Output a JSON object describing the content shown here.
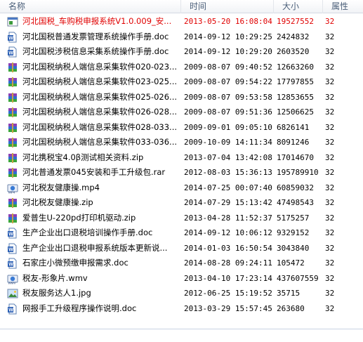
{
  "columns": {
    "name": "名称",
    "time": "时间",
    "size": "大小",
    "attr": "属性"
  },
  "rows": [
    {
      "name": "河北国税_车购税申报系统V1.0.009_安...",
      "time": "2013-05-20 16:08:04",
      "size": "19527552",
      "attr": "32",
      "icon": "installer-icon",
      "selected": true
    },
    {
      "name": "河北国税普通发票管理系统操作手册.doc",
      "time": "2014-09-12 10:29:25",
      "size": "2424832",
      "attr": "32",
      "icon": "word-doc-icon"
    },
    {
      "name": "河北国税涉税信息采集系统操作手册.doc",
      "time": "2014-09-12 10:29:20",
      "size": "2603520",
      "attr": "32",
      "icon": "word-doc-icon"
    },
    {
      "name": "河北国税纳税人端信息采集软件020-023...",
      "time": "2009-08-07 09:40:52",
      "size": "12663260",
      "attr": "32",
      "icon": "rar-archive-icon"
    },
    {
      "name": "河北国税纳税人端信息采集软件023-025...",
      "time": "2009-08-07 09:54:22",
      "size": "17797855",
      "attr": "32",
      "icon": "rar-archive-icon"
    },
    {
      "name": "河北国税纳税人端信息采集软件025-026...",
      "time": "2009-08-07 09:53:58",
      "size": "12853655",
      "attr": "32",
      "icon": "rar-archive-icon"
    },
    {
      "name": "河北国税纳税人端信息采集软件026-028...",
      "time": "2009-08-07 09:51:36",
      "size": "12506625",
      "attr": "32",
      "icon": "rar-archive-icon"
    },
    {
      "name": "河北国税纳税人端信息采集软件028-033...",
      "time": "2009-09-01 09:05:10",
      "size": "6826141",
      "attr": "32",
      "icon": "rar-archive-icon"
    },
    {
      "name": "河北国税纳税人端信息采集软件033-036...",
      "time": "2009-10-09 14:11:34",
      "size": "8091246",
      "attr": "32",
      "icon": "rar-archive-icon"
    },
    {
      "name": "河北携税宝4.0β测试相关资料.zip",
      "time": "2013-07-04 13:42:08",
      "size": "17014670",
      "attr": "32",
      "icon": "zip-archive-icon"
    },
    {
      "name": "河北普通发票045安装和手工升级包.rar",
      "time": "2012-08-03 15:36:13",
      "size": "195789910",
      "attr": "32",
      "icon": "rar-archive-icon"
    },
    {
      "name": "河北税友健康操.mp4",
      "time": "2014-07-25 00:07:40",
      "size": "60859032",
      "attr": "32",
      "icon": "mp4-video-icon"
    },
    {
      "name": "河北税友健康操.zip",
      "time": "2014-07-29 15:13:42",
      "size": "47498543",
      "attr": "32",
      "icon": "zip-archive-icon"
    },
    {
      "name": "爱普生U-220pd打印机驱动.zip",
      "time": "2013-04-28 11:52:37",
      "size": "5175257",
      "attr": "32",
      "icon": "rar-archive-icon"
    },
    {
      "name": "生产企业出口退税培训操作手册.doc",
      "time": "2014-09-12 10:06:12",
      "size": "9329152",
      "attr": "32",
      "icon": "word-doc-icon"
    },
    {
      "name": "生产企业出口退税申报系统版本更新说...",
      "time": "2014-01-03 16:50:54",
      "size": "3043840",
      "attr": "32",
      "icon": "word-doc-icon"
    },
    {
      "name": "石家庄小微预缴申报需求.doc",
      "time": "2014-08-28 09:24:11",
      "size": "105472",
      "attr": "32",
      "icon": "word-doc-icon"
    },
    {
      "name": "税友-形象片.wmv",
      "time": "2013-04-10 17:23:14",
      "size": "437607559",
      "attr": "32",
      "icon": "wmv-video-icon"
    },
    {
      "name": "税友服务达人1.jpg",
      "time": "2012-06-25 15:19:52",
      "size": "35715",
      "attr": "32",
      "icon": "jpg-image-icon"
    },
    {
      "name": "网报手工升级程序操作说明.doc",
      "time": "2013-03-29 15:57:45",
      "size": "263680",
      "attr": "32",
      "icon": "word-doc-icon"
    }
  ],
  "colors": {
    "selected_text": "#e00000",
    "header_text": "#4c607a"
  }
}
